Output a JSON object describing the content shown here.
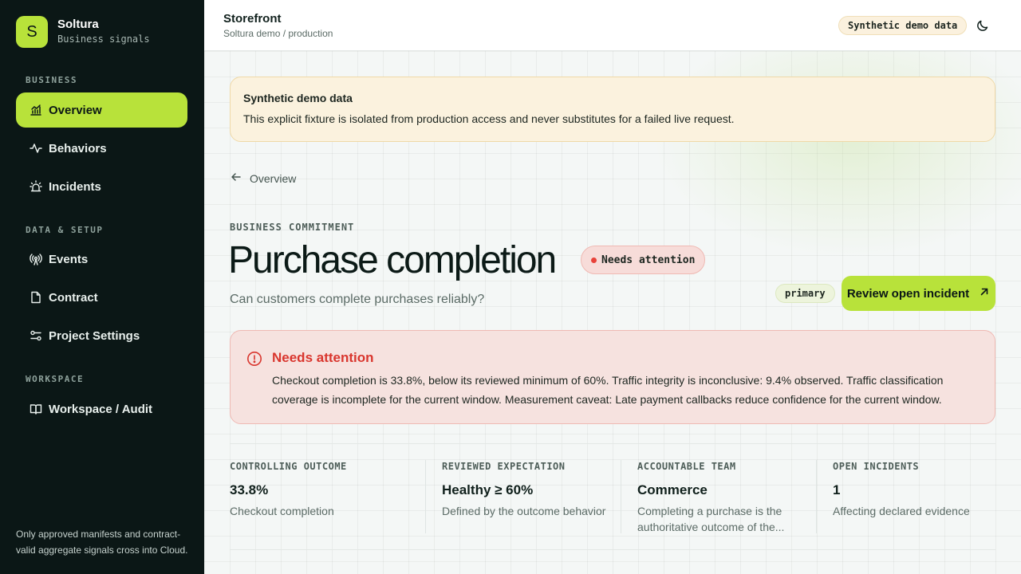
{
  "brand": {
    "logo_letter": "S",
    "name": "Soltura",
    "subtitle": "Business signals"
  },
  "sidebar": {
    "sections": [
      {
        "heading": "BUSINESS",
        "items": [
          {
            "label": "Overview",
            "icon": "bar-chart-icon",
            "active": true
          },
          {
            "label": "Behaviors",
            "icon": "activity-icon"
          },
          {
            "label": "Incidents",
            "icon": "siren-icon"
          }
        ]
      },
      {
        "heading": "DATA & SETUP",
        "items": [
          {
            "label": "Events",
            "icon": "radio-tower-icon"
          },
          {
            "label": "Contract",
            "icon": "file-icon"
          },
          {
            "label": "Project Settings",
            "icon": "sliders-icon"
          }
        ]
      },
      {
        "heading": "WORKSPACE",
        "items": [
          {
            "label": "Workspace / Audit",
            "icon": "book-open-icon"
          }
        ]
      }
    ],
    "footer": "Only approved manifests and contract-valid aggregate signals cross into Cloud."
  },
  "header": {
    "title": "Storefront",
    "subtitle": "Soltura demo / production",
    "badge": "Synthetic demo data",
    "theme_icon": "moon-icon"
  },
  "notice": {
    "title": "Synthetic demo data",
    "text": "This explicit fixture is isolated from production access and never substitutes for a failed live request."
  },
  "back_link": "Overview",
  "commitment": {
    "eyebrow": "BUSINESS COMMITMENT",
    "title": "Purchase completion",
    "status": "Needs attention",
    "subtitle": "Can customers complete purchases reliably?",
    "tag": "primary",
    "action_label": "Review open incident"
  },
  "alert": {
    "title": "Needs attention",
    "text": "Checkout completion is 33.8%, below its reviewed minimum of 60%. Traffic integrity is inconclusive: 9.4% observed. Traffic classification coverage is incomplete for the current window. Measurement caveat: Late payment callbacks reduce confidence for the current window."
  },
  "stats": [
    {
      "label": "CONTROLLING OUTCOME",
      "value": "33.8%",
      "desc": "Checkout completion"
    },
    {
      "label": "REVIEWED EXPECTATION",
      "value": "Healthy ≥ 60%",
      "desc": "Defined by the outcome behavior"
    },
    {
      "label": "ACCOUNTABLE TEAM",
      "value": "Commerce",
      "desc": "Completing a purchase is the authoritative outcome of the..."
    },
    {
      "label": "OPEN INCIDENTS",
      "value": "1",
      "desc": "Affecting declared evidence"
    }
  ]
}
